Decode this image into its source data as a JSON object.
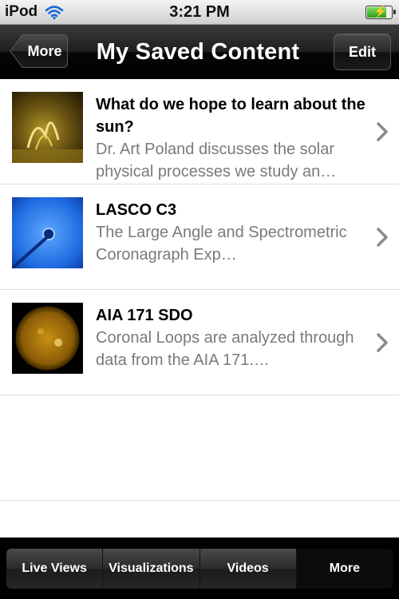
{
  "status_bar": {
    "carrier": "iPod",
    "time": "3:21 PM",
    "battery_level": 0.85
  },
  "nav": {
    "back_label": "More",
    "title": "My Saved Content",
    "edit_label": "Edit"
  },
  "items": [
    {
      "title": "What do we hope to learn about the sun?",
      "description": "Dr. Art Poland discusses the solar physical processes we study an…",
      "thumb": "solar-prominence-image"
    },
    {
      "title": "LASCO C3",
      "description": "The Large Angle and Spectrometric Coronagraph Exp…",
      "thumb": "coronagraph-image"
    },
    {
      "title": "AIA 171 SDO",
      "description": "Coronal Loops are analyzed through data from the AIA 171.…",
      "thumb": "sun-disk-image"
    }
  ],
  "tabs": [
    {
      "label": "Live Views",
      "active": false
    },
    {
      "label": "Visualizations",
      "active": false
    },
    {
      "label": "Videos",
      "active": false
    },
    {
      "label": "More",
      "active": true
    }
  ]
}
